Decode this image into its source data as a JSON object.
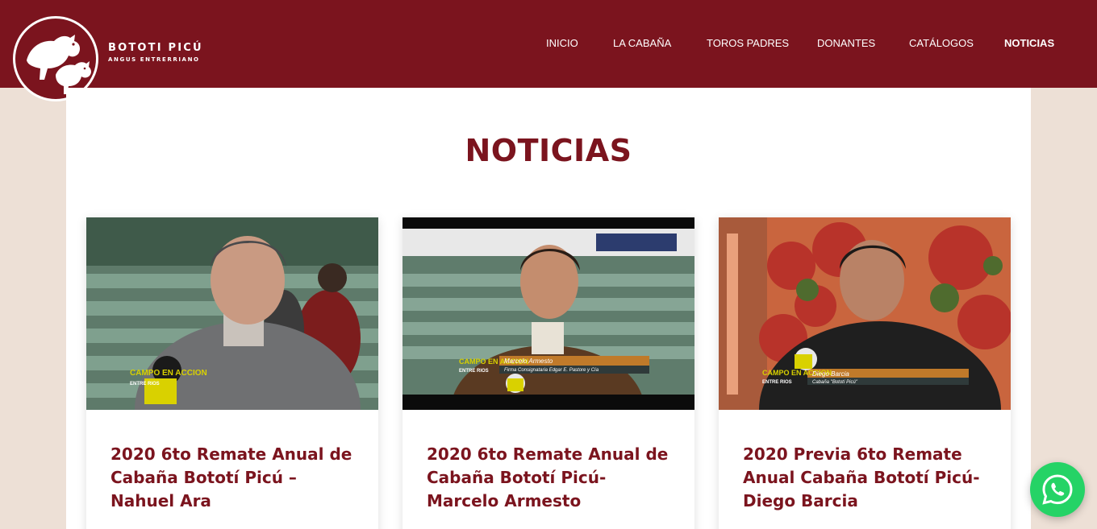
{
  "brand": {
    "name": "BOTOTI PICÚ",
    "subtitle": "ANGUS ENTRERRIANO",
    "logo_icon": "cattle-logo-icon"
  },
  "nav": {
    "items": [
      {
        "label": "INICIO",
        "active": false
      },
      {
        "label": "LA CABAÑA",
        "active": false
      },
      {
        "label": "TOROS PADRES",
        "active": false
      },
      {
        "label": "DONANTES",
        "active": false
      },
      {
        "label": "CATÁLOGOS",
        "active": false
      },
      {
        "label": "NOTICIAS",
        "active": true
      }
    ]
  },
  "page": {
    "title": "NOTICIAS"
  },
  "cards": [
    {
      "title": "2020 6to Remate Anual de Cabaña Bototí Picú – Nahuel Ara",
      "lower_third": {
        "logo": "CAMPO EN ACCION",
        "sub": "ENTRE RIOS",
        "name": "",
        "role": ""
      }
    },
    {
      "title": "2020 6to Remate Anual de Cabaña Bototí Picú- Marcelo Armesto",
      "lower_third": {
        "logo": "CAMPO EN ACCION",
        "sub": "ENTRE RIOS",
        "name": "Marcelo Armesto",
        "role": "Firma Consignataria Edgar E. Pastore y Cía"
      }
    },
    {
      "title": "2020 Previa 6to Remate Anual Cabaña Bototí Picú- Diego Barcia",
      "lower_third": {
        "logo": "CAMPO EN ACCION",
        "sub": "ENTRE RIOS",
        "name": "Diego Barcia",
        "role": "Cabaña \"Bototí Picú\""
      }
    }
  ],
  "colors": {
    "primary": "#7b141e",
    "background": "#ede0d6",
    "whatsapp": "#25d366"
  },
  "whatsapp": {
    "icon": "whatsapp-icon"
  }
}
